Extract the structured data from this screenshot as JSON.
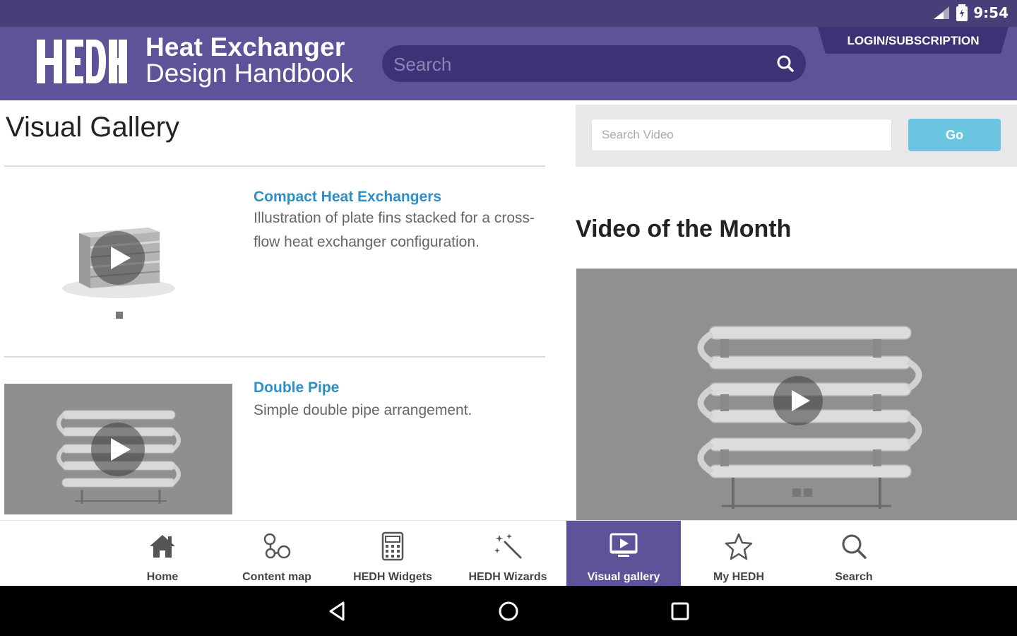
{
  "status_bar": {
    "time": "9:54"
  },
  "header": {
    "logo_text": "HEDH",
    "title_line1": "Heat Exchanger",
    "title_line2": "Design Handbook",
    "search_placeholder": "Search",
    "login_label": "LOGIN/SUBSCRIPTION"
  },
  "main": {
    "page_title": "Visual Gallery",
    "items": [
      {
        "title": "Compact Heat Exchangers",
        "description": "Illustration of plate fins stacked for a cross-flow heat exchanger configuration."
      },
      {
        "title": "Double Pipe",
        "description": "Simple double pipe arrangement."
      }
    ]
  },
  "sidebar": {
    "video_search_placeholder": "Search Video",
    "go_label": "Go",
    "video_of_month_title": "Video of the Month"
  },
  "bottom_nav": {
    "items": [
      {
        "label": "Home",
        "icon": "home-icon"
      },
      {
        "label": "Content map",
        "icon": "content-map-icon"
      },
      {
        "label": "HEDH Widgets",
        "icon": "calculator-icon"
      },
      {
        "label": "HEDH Wizards",
        "icon": "magic-wand-icon"
      },
      {
        "label": "Visual gallery",
        "icon": "video-screen-icon",
        "active": true
      },
      {
        "label": "My HEDH",
        "icon": "star-icon"
      },
      {
        "label": "Search",
        "icon": "search-icon"
      }
    ]
  },
  "colors": {
    "status_bar": "#463f78",
    "header": "#5c5399",
    "search_field": "#3c3377",
    "link": "#2e8fc8",
    "go_button": "#6bc4e0",
    "active_nav": "#5c5399"
  }
}
